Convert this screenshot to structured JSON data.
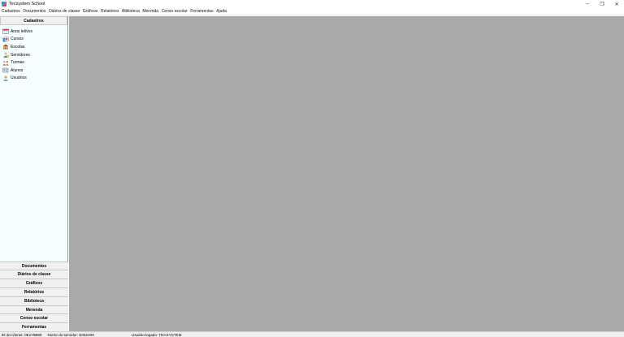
{
  "window": {
    "title": "Tecsystem School",
    "icon": "tecsystem-app-icon"
  },
  "window_controls": {
    "minimize": "–",
    "restore": "❐",
    "close": "✕"
  },
  "menu": [
    "Cadastros",
    "Documentos",
    "Diários de classe",
    "Gráficos",
    "Relatórios",
    "Biblioteca",
    "Merenda",
    "Censo escolar",
    "Ferramentas",
    "Ajuda"
  ],
  "sidebar": {
    "header": "Cadastros",
    "items": [
      {
        "label": "Anos letivos",
        "icon": "calendar-icon"
      },
      {
        "label": "Cursos",
        "icon": "courses-icon"
      },
      {
        "label": "Escolas",
        "icon": "school-icon"
      },
      {
        "label": "Servidores",
        "icon": "staff-icon"
      },
      {
        "label": "Turmas",
        "icon": "classes-icon"
      },
      {
        "label": "Alunos",
        "icon": "students-icon"
      },
      {
        "label": "Usuários",
        "icon": "user-icon"
      }
    ],
    "sections": [
      "Documentos",
      "Diários de classe",
      "Gráficos",
      "Relatórios",
      "Biblioteca",
      "Merenda",
      "Censo escolar",
      "Ferramentas"
    ]
  },
  "status": {
    "client_id": "ID do cliente: 0E176B98",
    "server_name": "Nome do servidor: E062200",
    "logged_user": "Usuário logado: TECSYSTEM"
  }
}
